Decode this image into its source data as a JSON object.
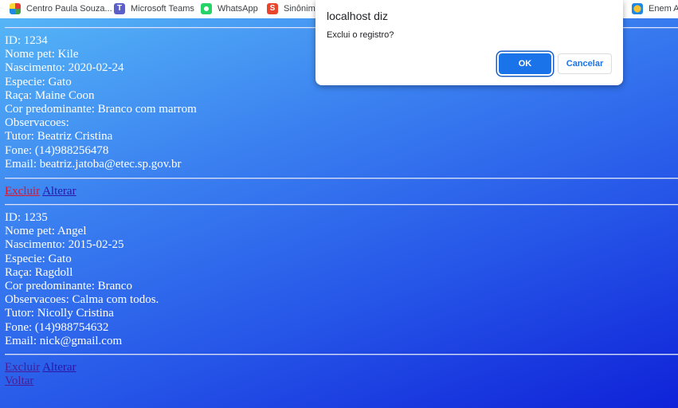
{
  "bookmarks": [
    {
      "label": "Centro Paula Souza...",
      "icon": "centro-paula-souza-icon"
    },
    {
      "label": "Microsoft Teams",
      "icon": "microsoft-teams-icon"
    },
    {
      "label": "WhatsApp",
      "icon": "whatsapp-icon"
    },
    {
      "label": "Sinônimo",
      "icon": "sinonimo-icon"
    },
    {
      "label": "Enem Ac",
      "icon": "enem-icon"
    }
  ],
  "records": [
    {
      "id": "ID: 1234",
      "nome": "Nome pet: Kile",
      "nascimento": "Nascimento: 2020-02-24",
      "especie": "Especie: Gato",
      "raca": "Raça: Maine Coon",
      "cor": "Cor predominante: Branco com marrom",
      "observacoes": "Observacoes:",
      "tutor": "Tutor: Beatriz Cristina",
      "fone": "Fone: (14)988256478",
      "email": "Email: beatriz.jatoba@etec.sp.gov.br",
      "excluir": "Excluir",
      "alterar": "Alterar"
    },
    {
      "id": "ID: 1235",
      "nome": "Nome pet: Angel",
      "nascimento": "Nascimento: 2015-02-25",
      "especie": "Especie: Gato",
      "raca": "Raça: Ragdoll",
      "cor": "Cor predominante: Branco",
      "observacoes": "Observacoes: Calma com todos.",
      "tutor": "Tutor: Nicolly Cristina",
      "fone": "Fone: (14)988754632",
      "email": "Email: nick@gmail.com",
      "excluir": "Excluir",
      "alterar": "Alterar"
    }
  ],
  "voltar": "Voltar",
  "dialog": {
    "title": "localhost diz",
    "message": "Exclui o registro?",
    "ok": "OK",
    "cancel": "Cancelar"
  },
  "colors": {
    "link_active": "#e0132b",
    "link": "#2a17a8",
    "link_visited": "#4a1b94",
    "button_primary": "#1a73e8"
  }
}
